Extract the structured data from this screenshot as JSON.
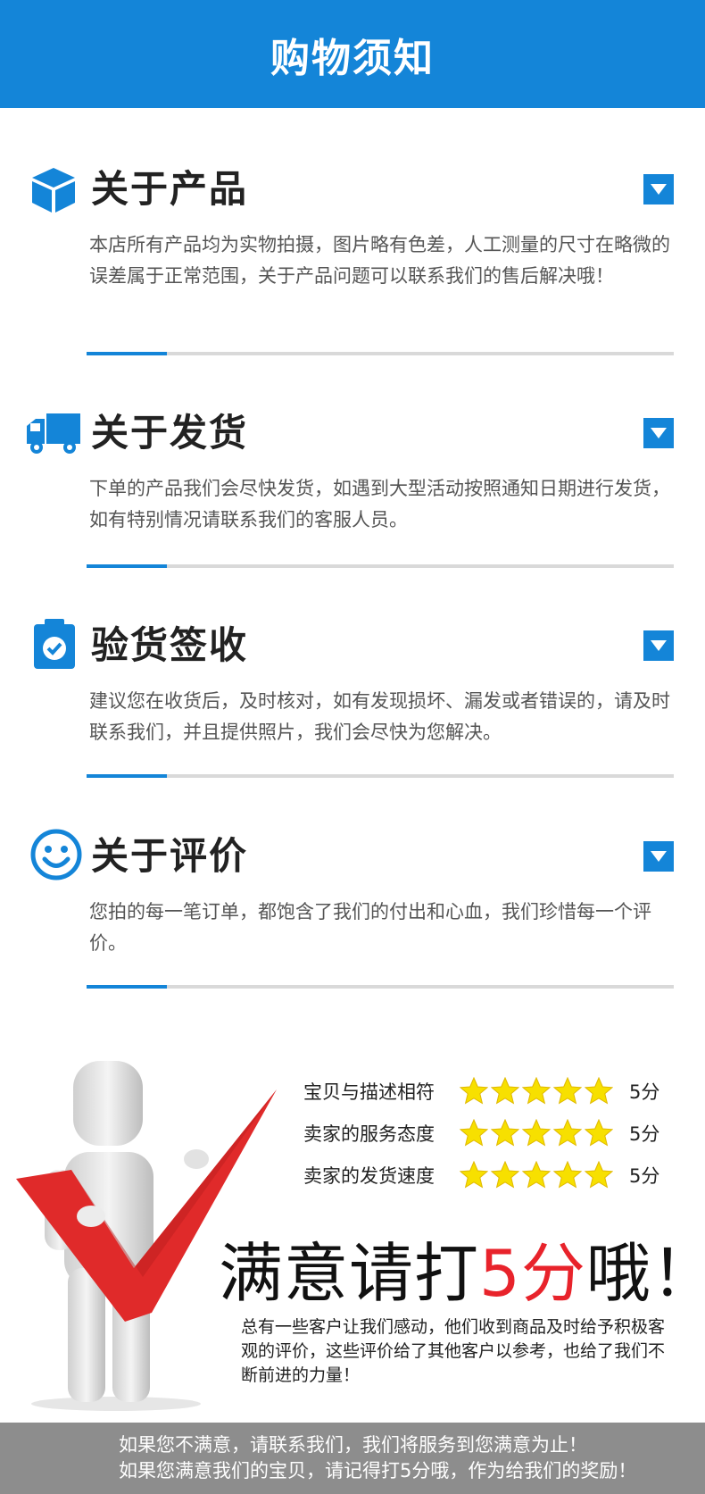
{
  "header": {
    "title": "购物须知"
  },
  "sections": [
    {
      "icon": "box-icon",
      "title": "关于产品",
      "body": "本店所有产品均为实物拍摄，图片略有色差，人工测量的尺寸在略微的误差属于正常范围，关于产品问题可以联系我们的售后解决哦！"
    },
    {
      "icon": "truck-icon",
      "title": "关于发货",
      "body": "下单的产品我们会尽快发货，如遇到大型活动按照通知日期进行发货，如有特别情况请联系我们的客服人员。"
    },
    {
      "icon": "clipboard-check-icon",
      "title": "验货签收",
      "body": "建议您在收货后，及时核对，如有发现损坏、漏发或者错误的，请及时联系我们，并且提供照片，我们会尽快为您解决。"
    },
    {
      "icon": "smiley-icon",
      "title": "关于评价",
      "body": "您拍的每一笔订单，都饱含了我们的付出和心血，我们珍惜每一个评价。"
    }
  ],
  "ratings": [
    {
      "label": "宝贝与描述相符",
      "stars": 5,
      "score": "5分"
    },
    {
      "label": "卖家的服务态度",
      "stars": 5,
      "score": "5分"
    },
    {
      "label": "卖家的发货速度",
      "stars": 5,
      "score": "5分"
    }
  ],
  "slogan": {
    "prefix": "满意请打",
    "highlight": "5分",
    "suffix": "哦！"
  },
  "praise": "总有一些客户让我们感动，他们收到商品及时给予积极客观的评价，这些评价给了其他客户以参考，也给了我们不断前进的力量！",
  "footer": {
    "line1": "如果您不满意，请联系我们，我们将服务到您满意为止！",
    "line2": "如果您满意我们的宝贝，请记得打5分哦，作为给我们的奖励！"
  },
  "colors": {
    "accent": "#1485d8",
    "highlight": "#e8232b",
    "star": "#f7e000",
    "footer": "#8d8d8d"
  }
}
